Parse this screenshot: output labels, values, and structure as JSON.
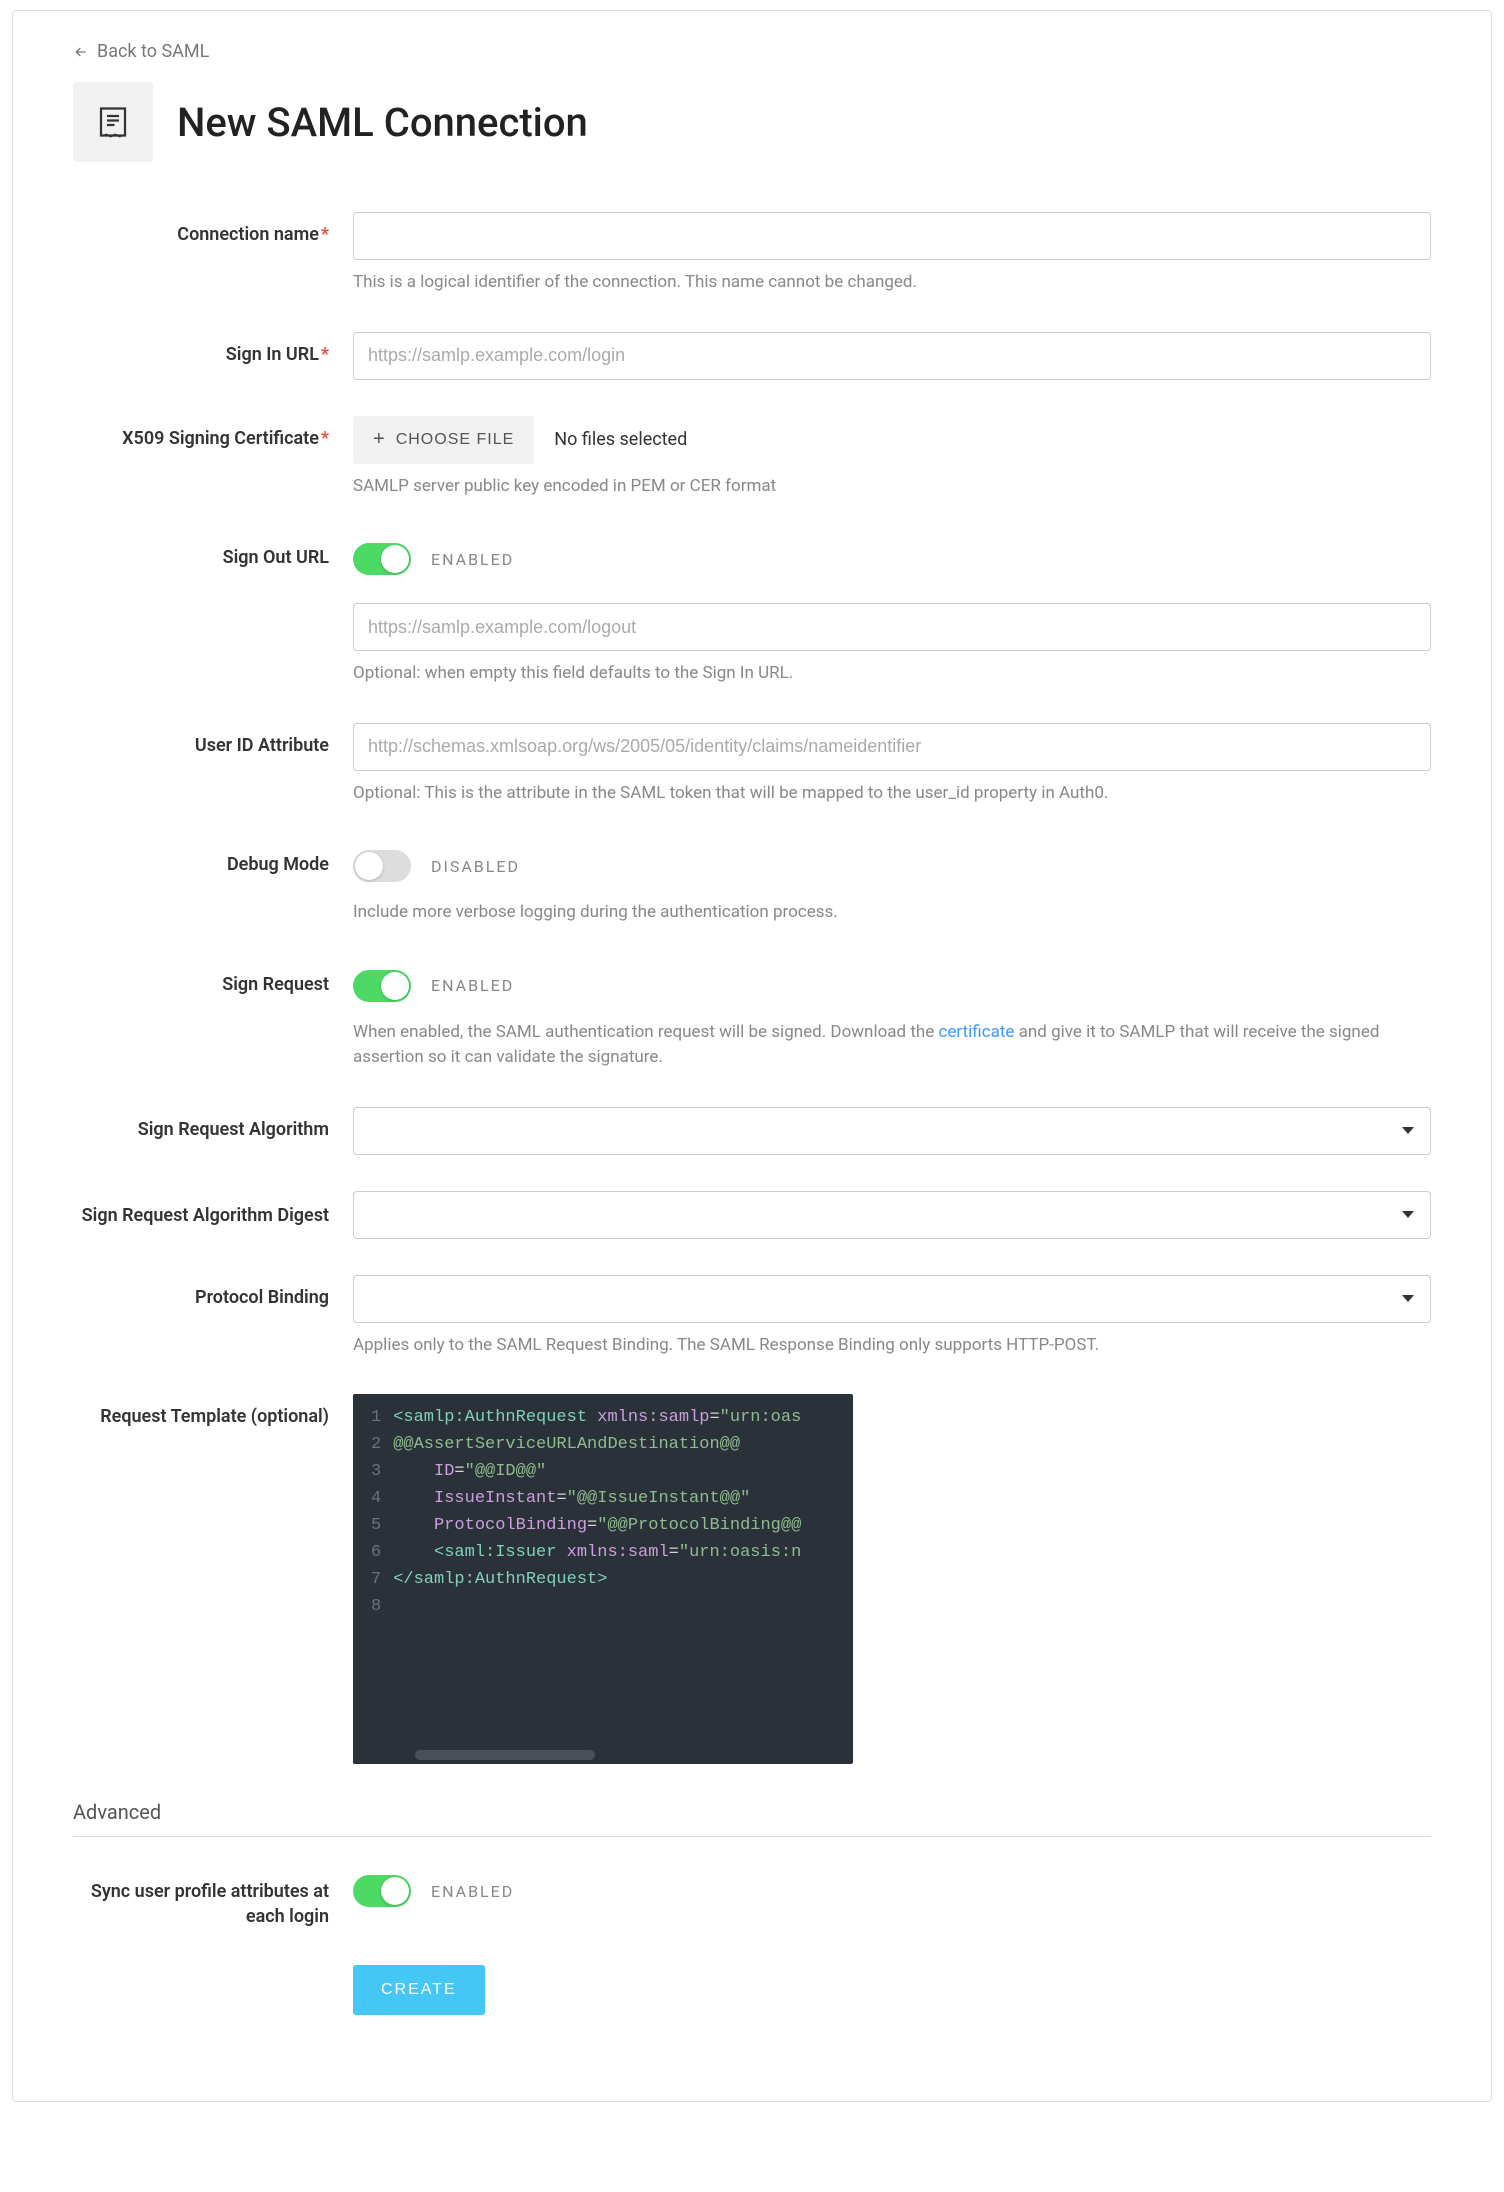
{
  "back_link": "Back to SAML",
  "page_title": "New SAML Connection",
  "fields": {
    "connection_name": {
      "label": "Connection name",
      "required": true,
      "value": "",
      "help": "This is a logical identifier of the connection. This name cannot be changed."
    },
    "sign_in_url": {
      "label": "Sign In URL",
      "required": true,
      "placeholder": "https://samlp.example.com/login",
      "value": ""
    },
    "x509_cert": {
      "label": "X509 Signing Certificate",
      "required": true,
      "button": "CHOOSE FILE",
      "status": "No files selected",
      "help": "SAMLP server public key encoded in PEM or CER format"
    },
    "sign_out_url": {
      "label": "Sign Out URL",
      "toggle_on": true,
      "toggle_label": "ENABLED",
      "placeholder": "https://samlp.example.com/logout",
      "value": "",
      "help": "Optional: when empty this field defaults to the Sign In URL."
    },
    "user_id_attr": {
      "label": "User ID Attribute",
      "placeholder": "http://schemas.xmlsoap.org/ws/2005/05/identity/claims/nameidentifier",
      "value": "",
      "help": "Optional: This is the attribute in the SAML token that will be mapped to the user_id property in Auth0."
    },
    "debug_mode": {
      "label": "Debug Mode",
      "toggle_on": false,
      "toggle_label": "DISABLED",
      "help": "Include more verbose logging during the authentication process."
    },
    "sign_request": {
      "label": "Sign Request",
      "toggle_on": true,
      "toggle_label": "ENABLED",
      "help_prefix": "When enabled, the SAML authentication request will be signed. Download the ",
      "help_link": "certificate",
      "help_suffix": " and give it to SAMLP that will receive the signed assertion so it can validate the signature."
    },
    "sign_req_algo": {
      "label": "Sign Request Algorithm"
    },
    "sign_req_algo_digest": {
      "label": "Sign Request Algorithm Digest"
    },
    "protocol_binding": {
      "label": "Protocol Binding",
      "help": "Applies only to the SAML Request Binding. The SAML Response Binding only supports HTTP-POST."
    },
    "request_template": {
      "label": "Request Template (optional)",
      "code_lines": [
        {
          "n": 1,
          "raw": "<samlp:AuthnRequest xmlns:samlp=\"urn:oas"
        },
        {
          "n": 2,
          "raw": "@@AssertServiceURLAndDestination@@"
        },
        {
          "n": 3,
          "raw": "    ID=\"@@ID@@\""
        },
        {
          "n": 4,
          "raw": "    IssueInstant=\"@@IssueInstant@@\""
        },
        {
          "n": 5,
          "raw": "    ProtocolBinding=\"@@ProtocolBinding@@"
        },
        {
          "n": 6,
          "raw": "    <saml:Issuer xmlns:saml=\"urn:oasis:n"
        },
        {
          "n": 7,
          "raw": "</samlp:AuthnRequest>"
        },
        {
          "n": 8,
          "raw": ""
        }
      ]
    }
  },
  "advanced": {
    "title": "Advanced",
    "sync_attributes": {
      "label": "Sync user profile attributes at each login",
      "toggle_on": true,
      "toggle_label": "ENABLED"
    }
  },
  "create_button": "CREATE"
}
